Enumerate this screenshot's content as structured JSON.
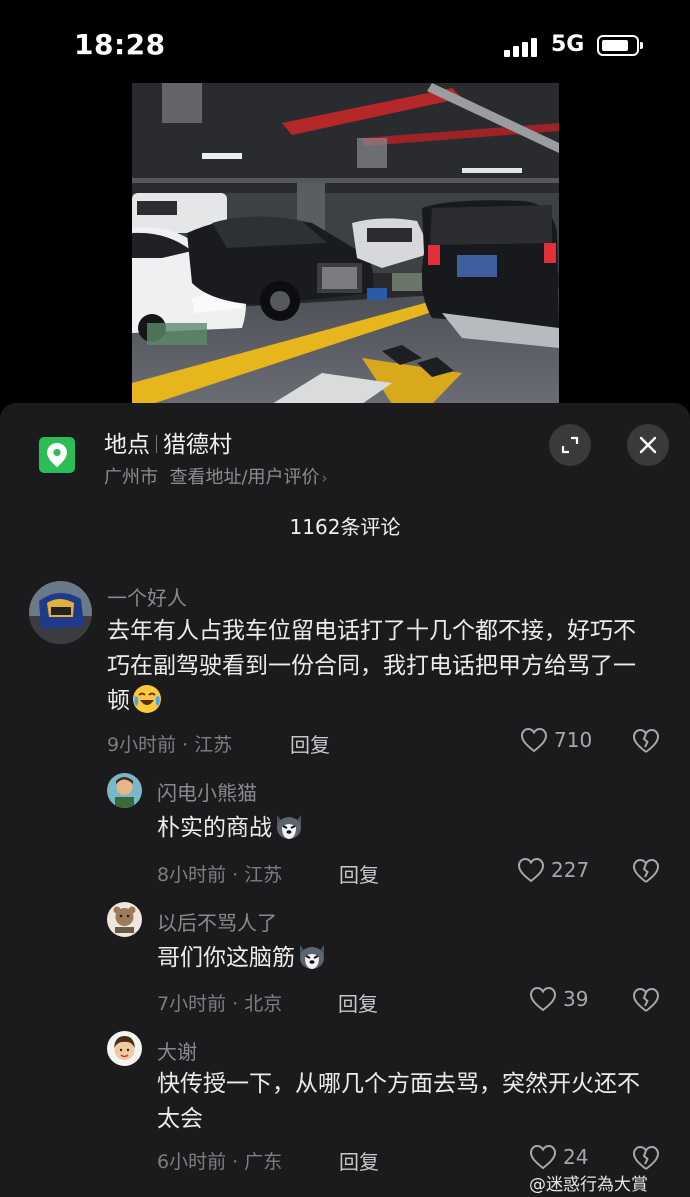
{
  "status": {
    "time": "18:28",
    "network": "5G"
  },
  "location": {
    "title_prefix": "地点",
    "place": "猎德村",
    "city": "广州市",
    "link": "查看地址/用户评价"
  },
  "comments_header": "1162条评论",
  "comments": [
    {
      "name": "一个好人",
      "text": "去年有人占我车位留电话打了十几个都不接，好巧不巧在副驾驶看到一份合同，我打电话把甲方给骂了一顿",
      "emoji": "crying-laughing",
      "meta": "9小时前 · 江苏",
      "reply": "回复",
      "likes": "710"
    },
    {
      "name": "闪电小熊猫",
      "text": "朴实的商战",
      "emoji": "husky",
      "meta": "8小时前 · 江苏",
      "reply": "回复",
      "likes": "227"
    },
    {
      "name": "以后不骂人了",
      "text": "哥们你这脑筋",
      "emoji": "husky",
      "meta": "7小时前 · 北京",
      "reply": "回复",
      "likes": "39"
    },
    {
      "name": "大谢",
      "text": "快传授一下，从哪几个方面去骂，突然开火还不太会",
      "emoji": "",
      "meta": "6小时前 · 广东",
      "reply": "回复",
      "likes": "24"
    }
  ],
  "watermark": "@迷惑行為大賞",
  "colors": {
    "location_green": "#2cbd57",
    "sheet_bg": "#1b1b1d",
    "parking_line": "#e7b51c"
  }
}
